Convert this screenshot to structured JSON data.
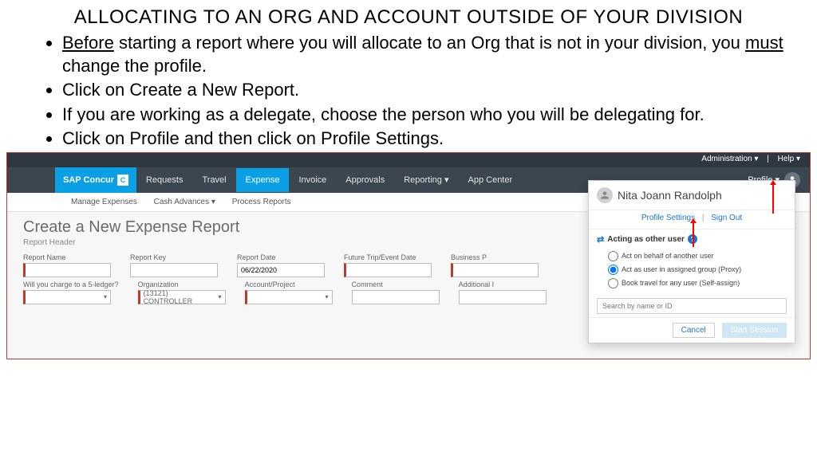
{
  "title": "ALLOCATING TO AN ORG AND ACCOUNT OUTSIDE OF YOUR DIVISION",
  "bullets": {
    "b1a": "Before",
    "b1b": " starting a report where you will allocate to an Org that is not in your division, you ",
    "b1c": "must",
    "b1d": " change the profile.",
    "b2": "Click on Create a New Report.",
    "b3": "If you are working as a delegate, choose the person who you will be delegating for.",
    "b4": "Click on Profile and then click on Profile Settings."
  },
  "admin": {
    "admin": "Administration ▾",
    "div": "|",
    "help": "Help ▾"
  },
  "logo": {
    "brand": "SAP Concur",
    "c": "C"
  },
  "nav": {
    "requests": "Requests",
    "travel": "Travel",
    "expense": "Expense",
    "invoice": "Invoice",
    "approvals": "Approvals",
    "reporting": "Reporting ▾",
    "appcenter": "App Center"
  },
  "profile": {
    "label": "Profile ▾"
  },
  "subnav": {
    "manage": "Manage Expenses",
    "cash": "Cash Advances ▾",
    "process": "Process Reports"
  },
  "page": {
    "heading": "Create a New Expense Report",
    "sub": "Report Header"
  },
  "fields": {
    "r1": {
      "name": "Report Name",
      "key": "Report Key",
      "date": "Report Date",
      "dateval": "06/22/2020",
      "trip": "Future Trip/Event Date",
      "biz": "Business P"
    },
    "r2": {
      "ledger": "Will you charge to a 5-ledger?",
      "org": "Organization",
      "orgval": "(13121) CONTROLLER",
      "acct": "Account/Project",
      "comment": "Comment",
      "addl": "Additional I"
    }
  },
  "pop": {
    "name": "Nita Joann Randolph",
    "settings": "Profile Settings",
    "signout": "Sign Out",
    "acting": "Acting as other user",
    "r1": "Act on behalf of another user",
    "r2": "Act as user in assigned group (Proxy)",
    "r3": "Book travel for any user (Self-assign)",
    "search": "Search by name or ID",
    "cancel": "Cancel",
    "start": "Start Session"
  }
}
